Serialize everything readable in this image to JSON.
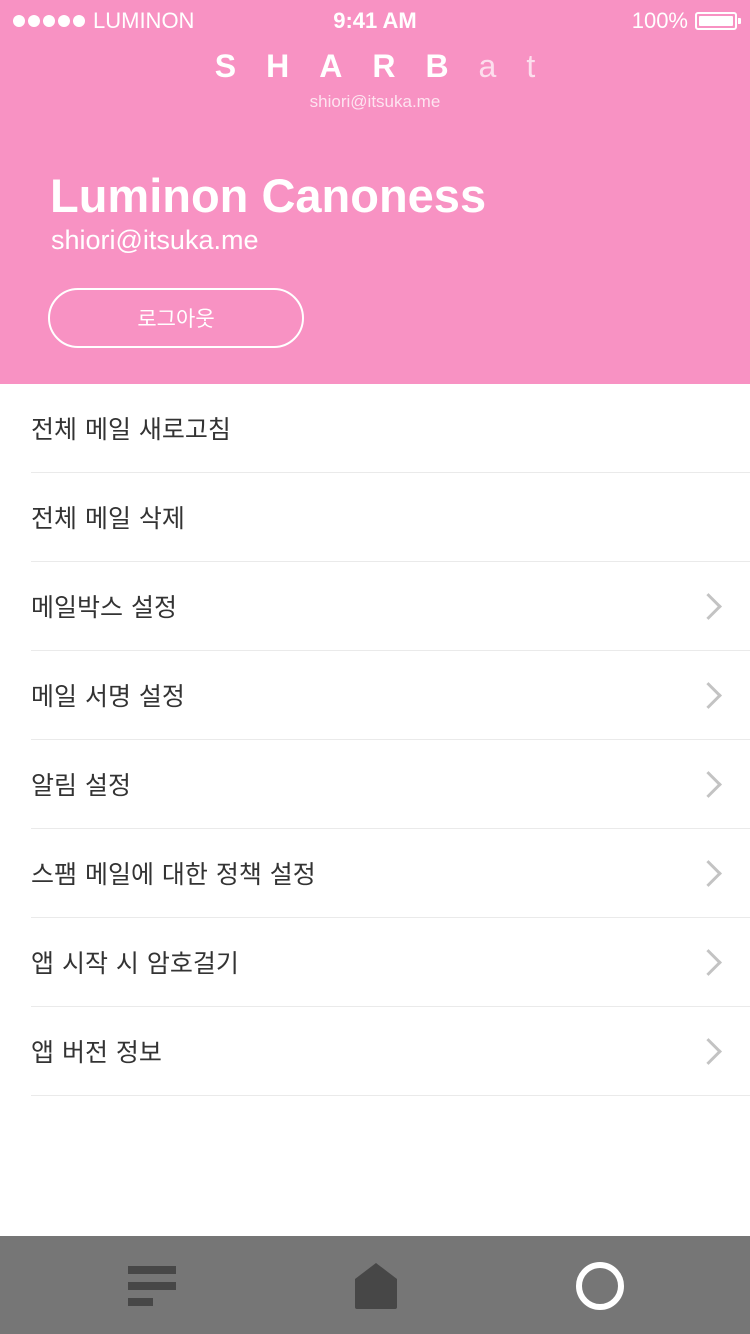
{
  "status_bar": {
    "carrier": "LUMINON",
    "time": "9:41 AM",
    "battery": "100%"
  },
  "header": {
    "logo_bold": "SHARB",
    "logo_light": "at",
    "logo_sub": "shiori@itsuka.me",
    "profile_name": "Luminon Canoness",
    "profile_email": "shiori@itsuka.me",
    "logout_label": "로그아웃",
    "background_color": "#f892c3"
  },
  "menu": {
    "items": [
      {
        "label": "전체 메일 새로고침",
        "has_chevron": false
      },
      {
        "label": "전체 메일 삭제",
        "has_chevron": false
      },
      {
        "label": "메일박스 설정",
        "has_chevron": true
      },
      {
        "label": "메일 서명 설정",
        "has_chevron": true
      },
      {
        "label": "알림 설정",
        "has_chevron": true
      },
      {
        "label": "스팸 메일에 대한 정책 설정",
        "has_chevron": true
      },
      {
        "label": "앱 시작 시 암호걸기",
        "has_chevron": true
      },
      {
        "label": "앱 버전 정보",
        "has_chevron": true
      }
    ]
  },
  "tab_bar": {
    "background_color": "#767676",
    "tabs": [
      {
        "icon": "list-icon"
      },
      {
        "icon": "home-icon"
      },
      {
        "icon": "profile-icon",
        "active": true
      }
    ]
  }
}
